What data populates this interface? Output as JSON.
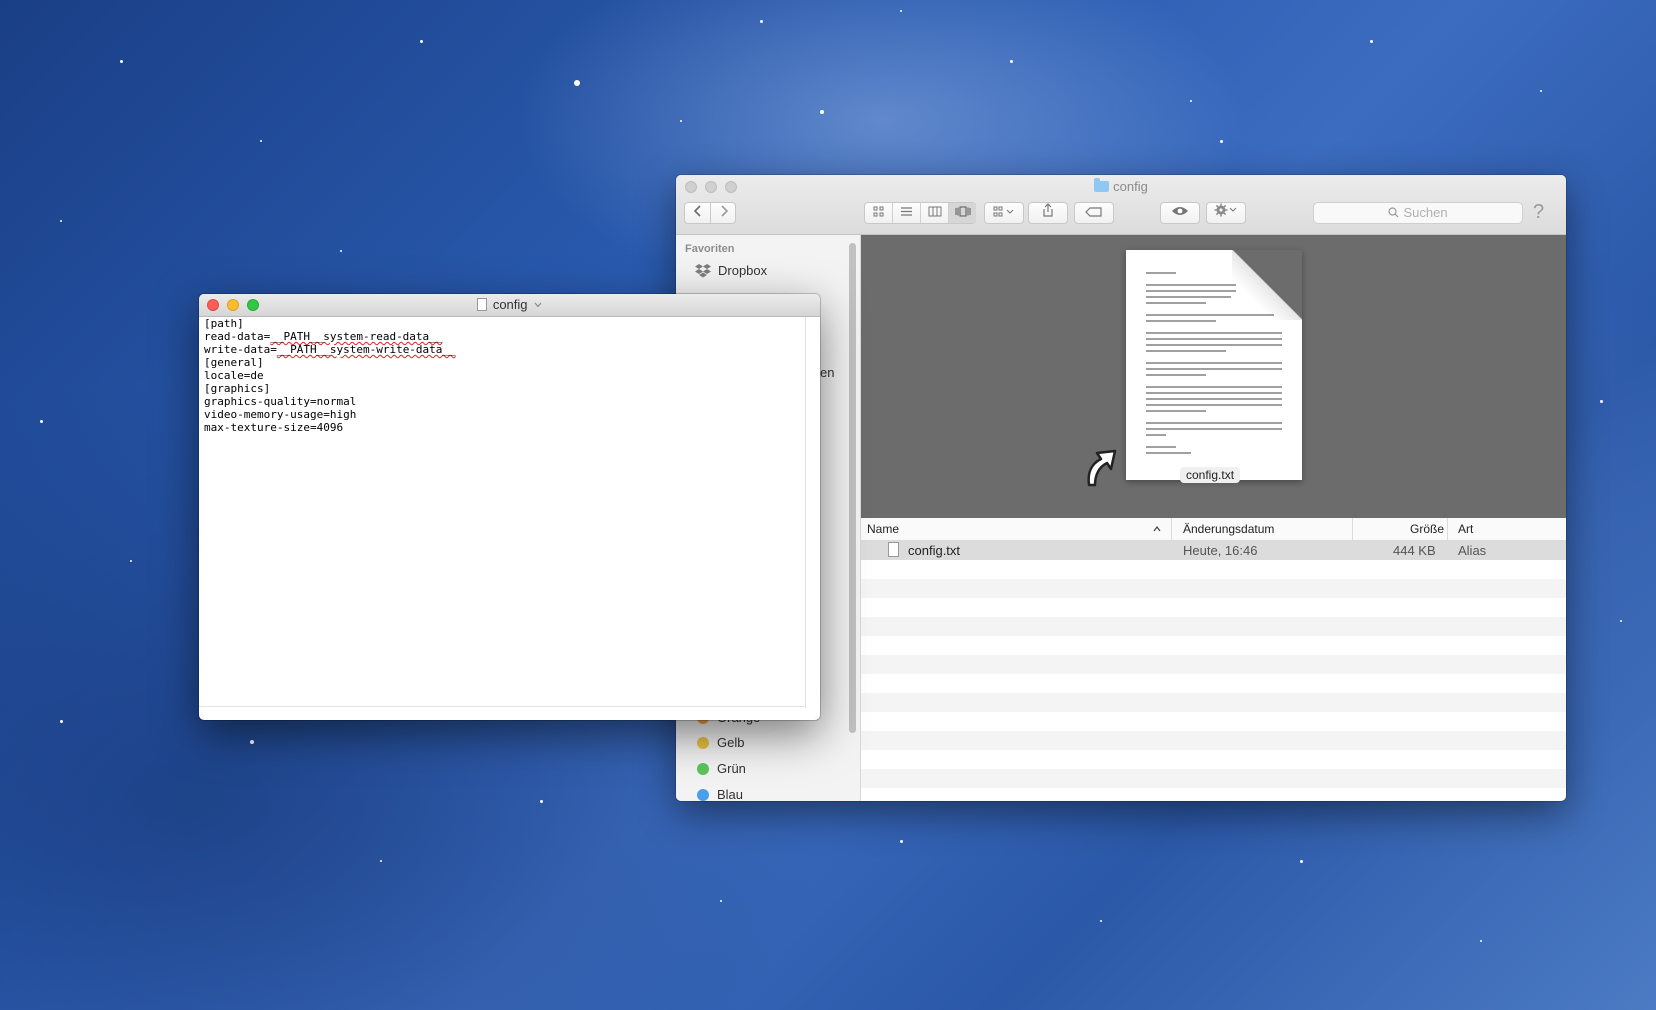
{
  "finder": {
    "title": "config",
    "search_placeholder": "Suchen",
    "help_glyph": "?",
    "sidebar": {
      "favorites_header": "Favoriten",
      "dropbox": "Dropbox",
      "partial_label": "en",
      "tags": [
        {
          "label": "Orange",
          "color": "#f0a040"
        },
        {
          "label": "Gelb",
          "color": "#e8c440"
        },
        {
          "label": "Grün",
          "color": "#5cc45c"
        },
        {
          "label": "Blau",
          "color": "#4aa0e8"
        }
      ]
    },
    "preview_filename": "config.txt",
    "columns": {
      "name": "Name",
      "date": "Änderungsdatum",
      "size": "Größe",
      "kind": "Art"
    },
    "rows": [
      {
        "name": "config.txt",
        "date": "Heute, 16:46",
        "size": "444 KB",
        "kind": "Alias"
      }
    ]
  },
  "textedit": {
    "title": "config",
    "lines": [
      "[path]",
      "read-data=__PATH__system-read-data__",
      "write-data=__PATH__system-write-data__",
      "[general]",
      "locale=de",
      "[graphics]",
      "graphics-quality=normal",
      "video-memory-usage=high",
      "max-texture-size=4096"
    ]
  }
}
